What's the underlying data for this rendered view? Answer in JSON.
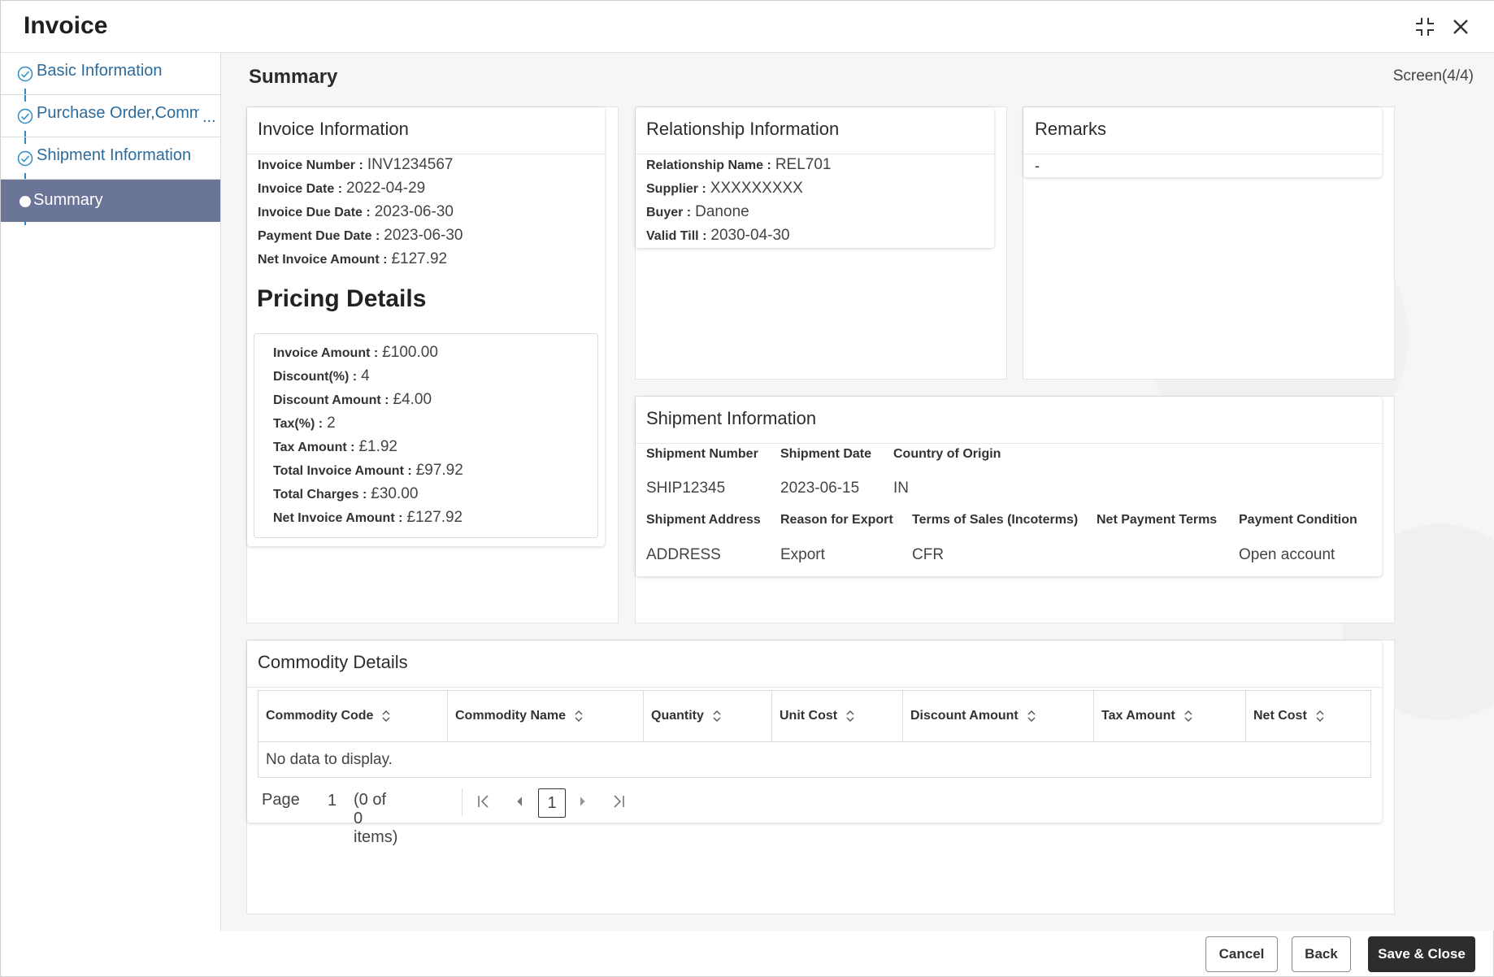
{
  "window": {
    "title": "Invoice"
  },
  "sidebar": {
    "items": [
      {
        "label": "Basic Information"
      },
      {
        "label": "Purchase Order,Commo"
      },
      {
        "label": "Shipment Information"
      },
      {
        "label": "Summary"
      }
    ],
    "more": "..."
  },
  "main": {
    "title": "Summary",
    "screen_indicator": "Screen(4/4)"
  },
  "invoice_info": {
    "title": "Invoice Information",
    "fields": [
      {
        "label": "Invoice Number :",
        "value": "INV1234567"
      },
      {
        "label": "Invoice Date :",
        "value": "2022-04-29"
      },
      {
        "label": "Invoice Due Date :",
        "value": "2023-06-30"
      },
      {
        "label": "Payment Due Date :",
        "value": "2023-06-30"
      },
      {
        "label": "Net Invoice Amount :",
        "value": "£127.92"
      }
    ]
  },
  "pricing": {
    "title": "Pricing Details",
    "fields": [
      {
        "label": "Invoice Amount :",
        "value": "£100.00"
      },
      {
        "label": "Discount(%) :",
        "value": "4"
      },
      {
        "label": "Discount Amount :",
        "value": "£4.00"
      },
      {
        "label": "Tax(%) :",
        "value": "2"
      },
      {
        "label": "Tax Amount :",
        "value": "£1.92"
      },
      {
        "label": "Total Invoice Amount :",
        "value": "£97.92"
      },
      {
        "label": "Total Charges :",
        "value": "£30.00"
      },
      {
        "label": "Net Invoice Amount :",
        "value": "£127.92"
      }
    ]
  },
  "relationship": {
    "title": "Relationship Information",
    "fields": [
      {
        "label": "Relationship Name :",
        "value": "REL701"
      },
      {
        "label": "Supplier :",
        "value": "XXXXXXXXX"
      },
      {
        "label": "Buyer :",
        "value": "Danone"
      },
      {
        "label": "Valid Till :",
        "value": "2030-04-30"
      }
    ]
  },
  "remarks": {
    "title": "Remarks",
    "value": "-"
  },
  "shipment": {
    "title": "Shipment Information",
    "row1": [
      {
        "label": "Shipment Number",
        "value": "SHIP12345"
      },
      {
        "label": "Shipment Date",
        "value": "2023-06-15"
      },
      {
        "label": "Country of Origin",
        "value": "IN"
      }
    ],
    "row2": [
      {
        "label": "Shipment Address",
        "value": "ADDRESS"
      },
      {
        "label": "Reason for Export",
        "value": "Export"
      },
      {
        "label": "Terms of Sales (Incoterms)",
        "value": "CFR"
      },
      {
        "label": "Net Payment Terms",
        "value": ""
      },
      {
        "label": "Payment Condition",
        "value": "Open account"
      }
    ]
  },
  "commodity": {
    "title": "Commodity Details",
    "columns": [
      "Commodity Code",
      "Commodity Name",
      "Quantity",
      "Unit Cost",
      "Discount Amount",
      "Tax Amount",
      "Net Cost"
    ],
    "empty_text": "No data to display.",
    "pager": {
      "label": "Page",
      "page": "1",
      "items": "(0 of 0 items)",
      "current": "1"
    }
  },
  "footer": {
    "cancel": "Cancel",
    "back": "Back",
    "save_close": "Save & Close"
  },
  "colors": {
    "active_nav": "#6b7597",
    "link": "#2d6b9a",
    "primary_button": "#2d2d2d"
  },
  "icons": [
    "minimize-icon",
    "close-icon",
    "check-circle-icon",
    "sort-icon",
    "first-page-icon",
    "prev-page-icon",
    "next-page-icon",
    "last-page-icon"
  ]
}
